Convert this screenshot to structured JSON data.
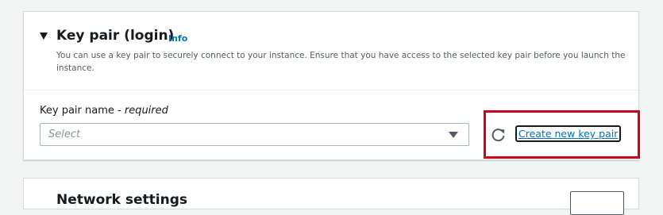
{
  "key_pair_section": {
    "title": "Key pair (login)",
    "info_link": "Info",
    "description": "You can use a key pair to securely connect to your instance. Ensure that you have access to the selected key pair before you launch the instance.",
    "field_label": "Key pair name - ",
    "field_label_required": "required",
    "select_placeholder": "Select",
    "create_link": "Create new key pair"
  },
  "next_section": {
    "title": "Network settings"
  },
  "colors": {
    "link": "#0073bb",
    "highlight": "#d0021b",
    "page_background": "#f2f3f3"
  },
  "icons": [
    "caret-down-icon",
    "dropdown-arrow-icon",
    "refresh-icon"
  ]
}
